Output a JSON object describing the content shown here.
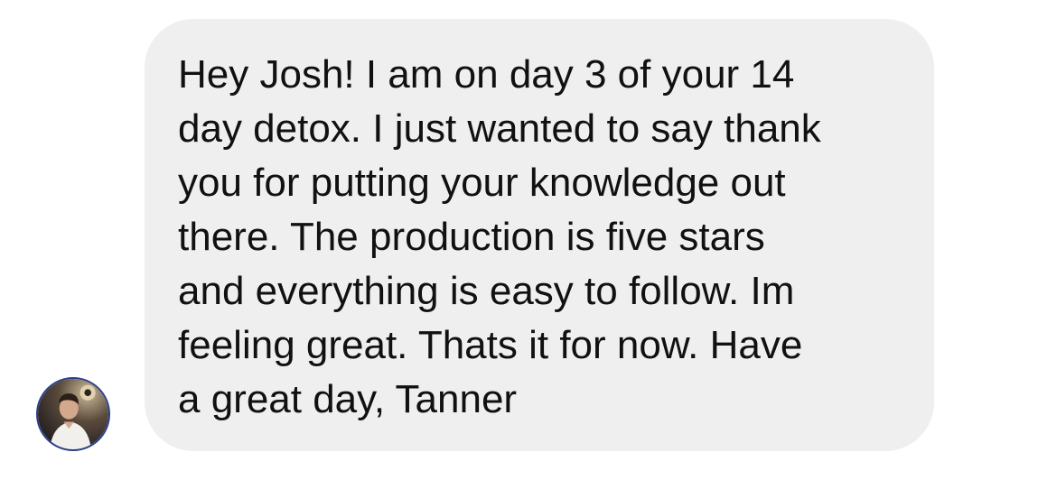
{
  "conversation": {
    "sender_avatar_icon": "person-photo-icon",
    "message": {
      "lines": [
        "Hey Josh! I am on day 3 of your 14",
        "day detox. I just wanted to say thank",
        "you for putting your knowledge out",
        "there. The production is five stars",
        "and everything is easy to follow. Im",
        "feeling great. Thats it for now. Have",
        "a great day, Tanner"
      ]
    }
  },
  "colors": {
    "bubble_background": "#efefef",
    "text": "#111111",
    "avatar_ring": "#2c3f8a"
  }
}
